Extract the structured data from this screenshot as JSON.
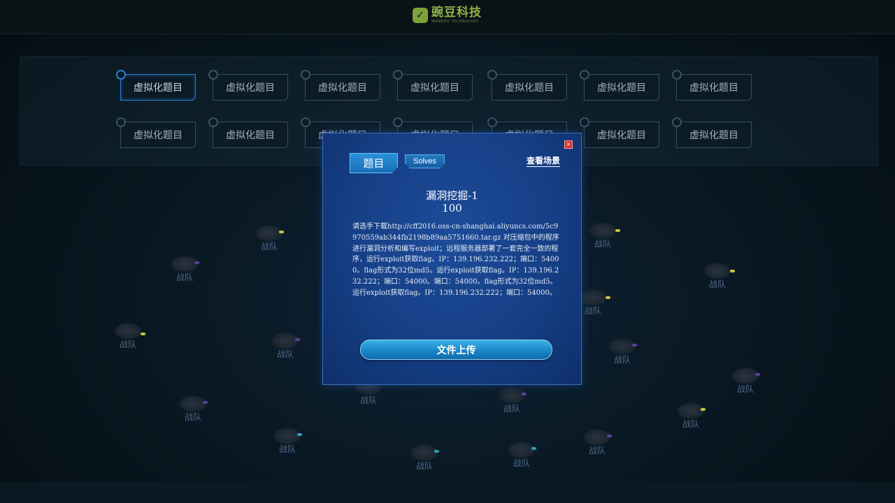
{
  "header": {
    "logo_cn": "豌豆科技",
    "logo_en": "WANDOU TECHNOLOGY"
  },
  "challenges": {
    "row1": [
      "虚拟化题目",
      "虚拟化题目",
      "虚拟化题目",
      "虚拟化题目",
      "虚拟化题目",
      "虚拟化题目",
      "虚拟化题目"
    ],
    "row2": [
      "虚拟化题目",
      "虚拟化题目",
      "虚拟化题目",
      "虚拟化题目",
      "虚拟化题目",
      "虚拟化题目",
      "虚拟化题目"
    ]
  },
  "teams": {
    "label": "战队"
  },
  "modal": {
    "close_label": "×",
    "tab_problem": "题目",
    "tab_solves": "Solves",
    "view_scene": "查看场景",
    "title": "漏洞挖掘-1",
    "score": "100",
    "description": "请选手下载http://cff2016.oss-cn-shanghai.aliyuncs.com/5c9970559ab344fb2198b89aa5751660.tar.gz 对压缩包中的程序进行漏洞分析和编写exploit；远程服务器部署了一套完全一致的程序，运行exploit获取flag。IP：139.196.232.222；端口：54000。flag形式为32位md5。运行exploit获取flag。IP：139.196.232.222；端口：54000。端口：54000。flag形式为32位md5。运行exploit获取flag。IP：139.196.232.222；端口：54000。",
    "upload_label": "文件上传"
  },
  "colors": {
    "modal_bg": "#163f86",
    "button": "#1b86c7",
    "team_label": "#50698c"
  }
}
